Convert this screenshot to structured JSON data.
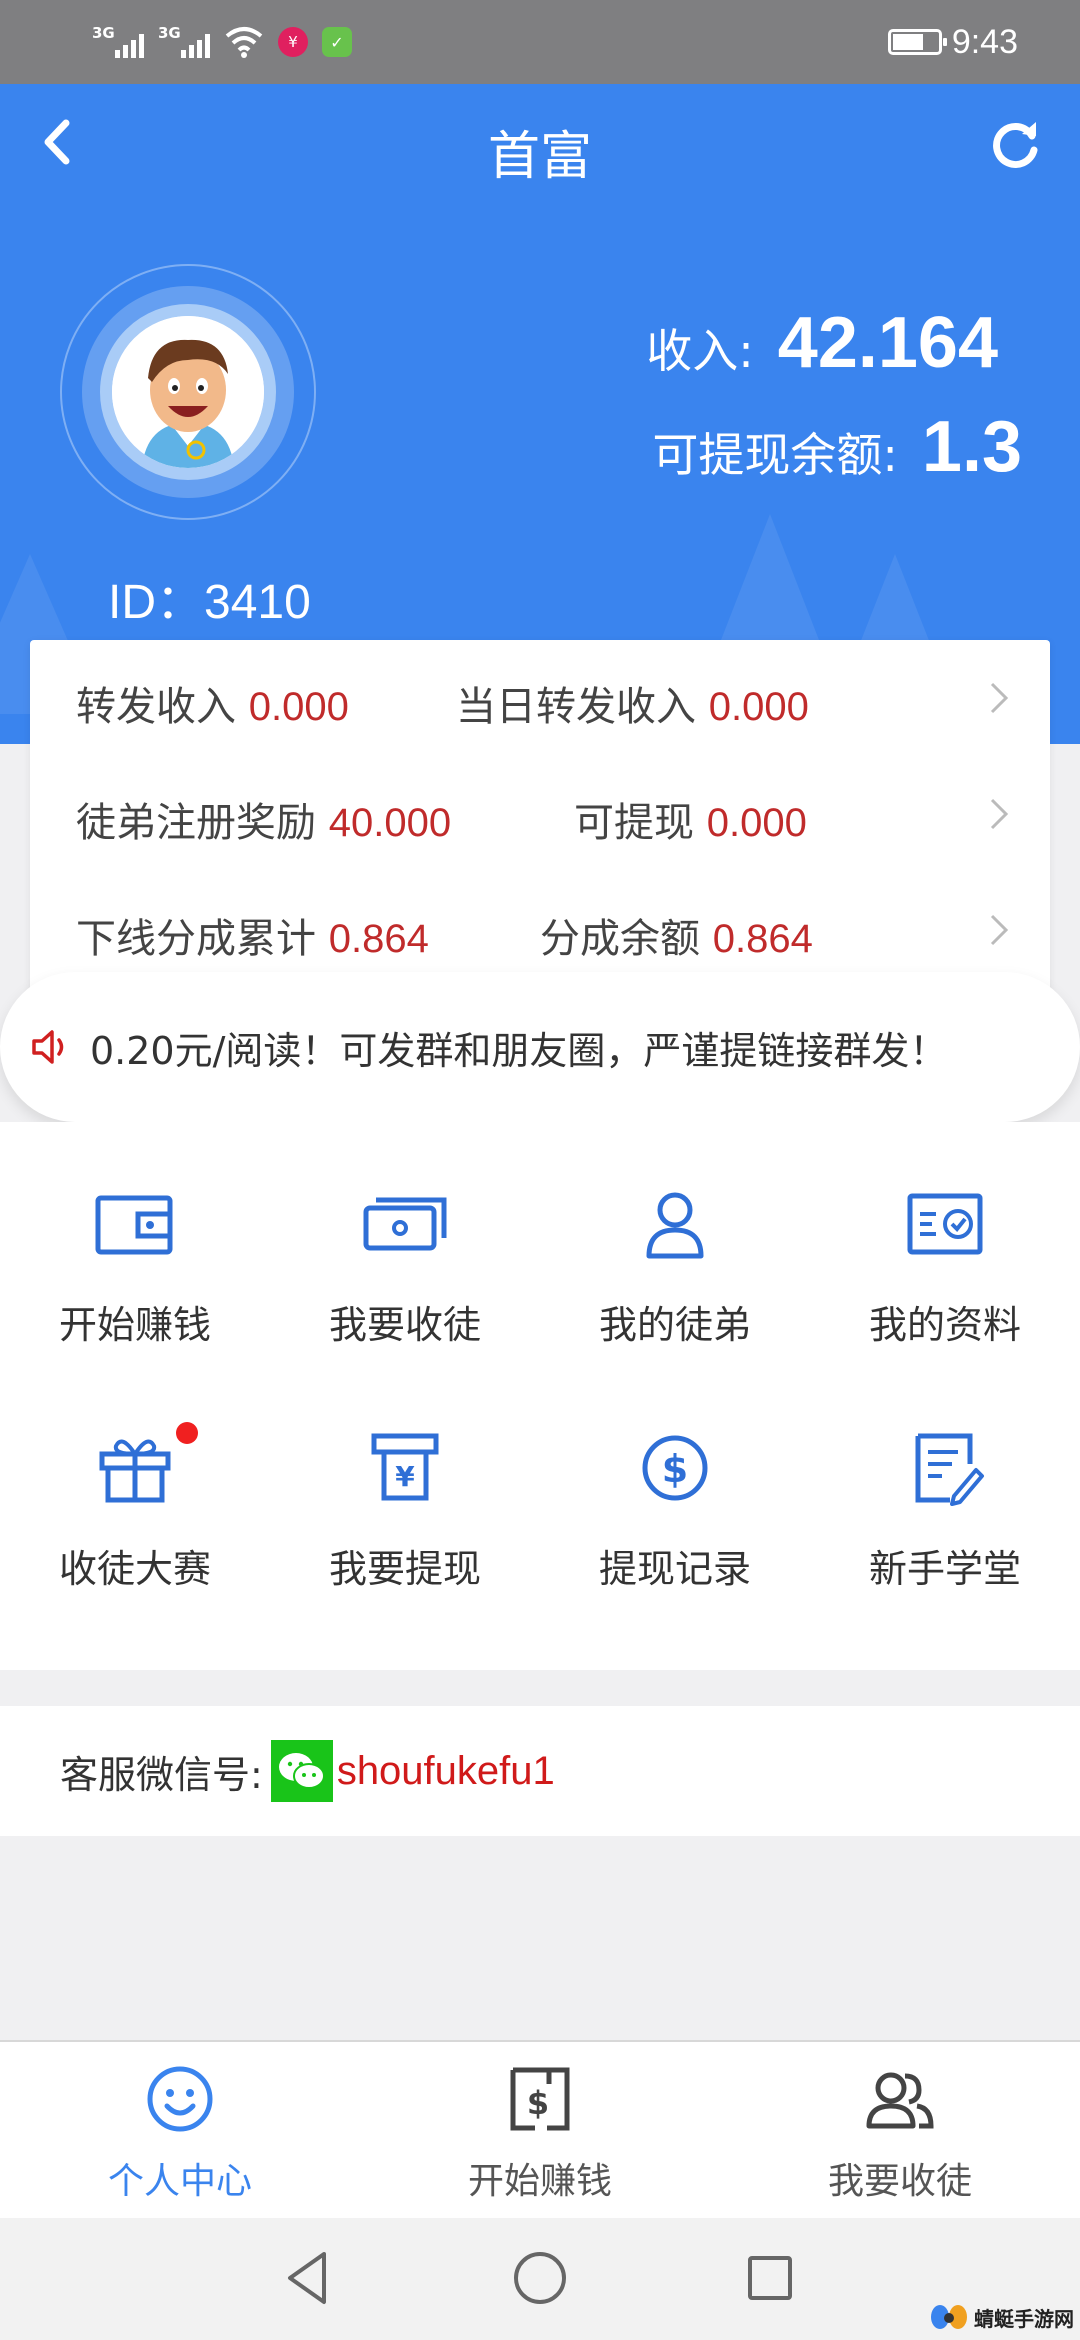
{
  "status_bar": {
    "sim1": "3G",
    "sim2": "3G",
    "app_badge_1": "¥",
    "app_badge_2": "✓",
    "time": "9:43"
  },
  "header": {
    "title": "首富",
    "user_id": "ID：3410",
    "income_label": "收入:",
    "income_value": "42.164",
    "balance_label": "可提现余额:",
    "balance_value": "1.3"
  },
  "stats": [
    {
      "label_1": "转发收入",
      "value_1": "0.000",
      "label_2": "当日转发收入",
      "value_2": "0.000"
    },
    {
      "label_1": "徒弟注册奖励",
      "value_1": "40.000",
      "label_2": "可提现",
      "value_2": "0.000"
    },
    {
      "label_1": "下线分成累计",
      "value_1": "0.864",
      "label_2": "分成余额",
      "value_2": "0.864"
    }
  ],
  "notice": {
    "text": "0.20元/阅读！可发群和朋友圈，严谨提链接群发！"
  },
  "menu": [
    {
      "label": "开始赚钱",
      "icon": "wallet-icon"
    },
    {
      "label": "我要收徒",
      "icon": "cash-icon"
    },
    {
      "label": "我的徒弟",
      "icon": "user-icon"
    },
    {
      "label": "我的资料",
      "icon": "profile-card-icon"
    },
    {
      "label": "收徒大赛",
      "icon": "gift-icon"
    },
    {
      "label": "我要提现",
      "icon": "atm-icon"
    },
    {
      "label": "提现记录",
      "icon": "dollar-circle-icon"
    },
    {
      "label": "新手学堂",
      "icon": "notebook-icon"
    }
  ],
  "contact": {
    "label": "客服微信号:",
    "wechat_id": "shoufukefu1"
  },
  "tabs": [
    {
      "label": "个人中心",
      "icon": "smile-icon",
      "active": true
    },
    {
      "label": "开始赚钱",
      "icon": "dollar-doc-icon",
      "active": false
    },
    {
      "label": "我要收徒",
      "icon": "users-icon",
      "active": false
    }
  ],
  "watermark": {
    "text": "蜻蜓手游网"
  },
  "colors": {
    "primary": "#3a84ee",
    "value_red": "#c02b2b",
    "icon_blue": "#2f6fd6",
    "wechat_green": "#19c419"
  }
}
